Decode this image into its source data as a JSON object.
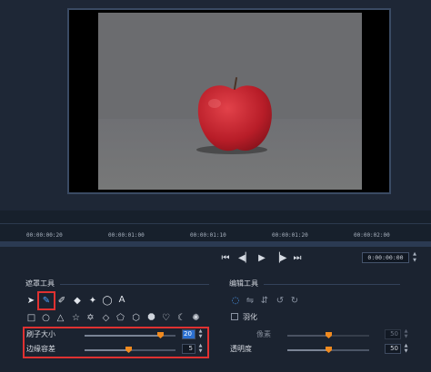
{
  "preview": {
    "background_color": "#6b6c6f",
    "apple_color": "#c4232e"
  },
  "timeline": {
    "timecodes": [
      "00:00:00:20",
      "00:00:01:00",
      "00:00:01:10",
      "00:00:01:20",
      "00:00:02:00"
    ]
  },
  "transport": {
    "prev_icon": "skip-back-icon",
    "step_back_icon": "step-back-icon",
    "play_icon": "play-icon",
    "step_fwd_icon": "step-forward-icon",
    "next_icon": "skip-forward-icon",
    "timecode": "0:00:00:00"
  },
  "mask_tools": {
    "title": "遮罩工具",
    "tool_letter": "A",
    "brush_size_label": "刷子大小",
    "brush_size_value": "20",
    "brush_size_level": 0.83,
    "edge_tolerance_label": "边缘容差",
    "edge_tolerance_value": "5",
    "edge_tolerance_level": 0.48,
    "highlight_color": "#e03131"
  },
  "edit_tools": {
    "title": "编辑工具",
    "feather_label": "羽化",
    "pixel_label": "像素",
    "pixel_value": "50",
    "pixel_level": 0.5,
    "opacity_label": "透明度",
    "opacity_value": "50",
    "opacity_level": 0.5
  }
}
